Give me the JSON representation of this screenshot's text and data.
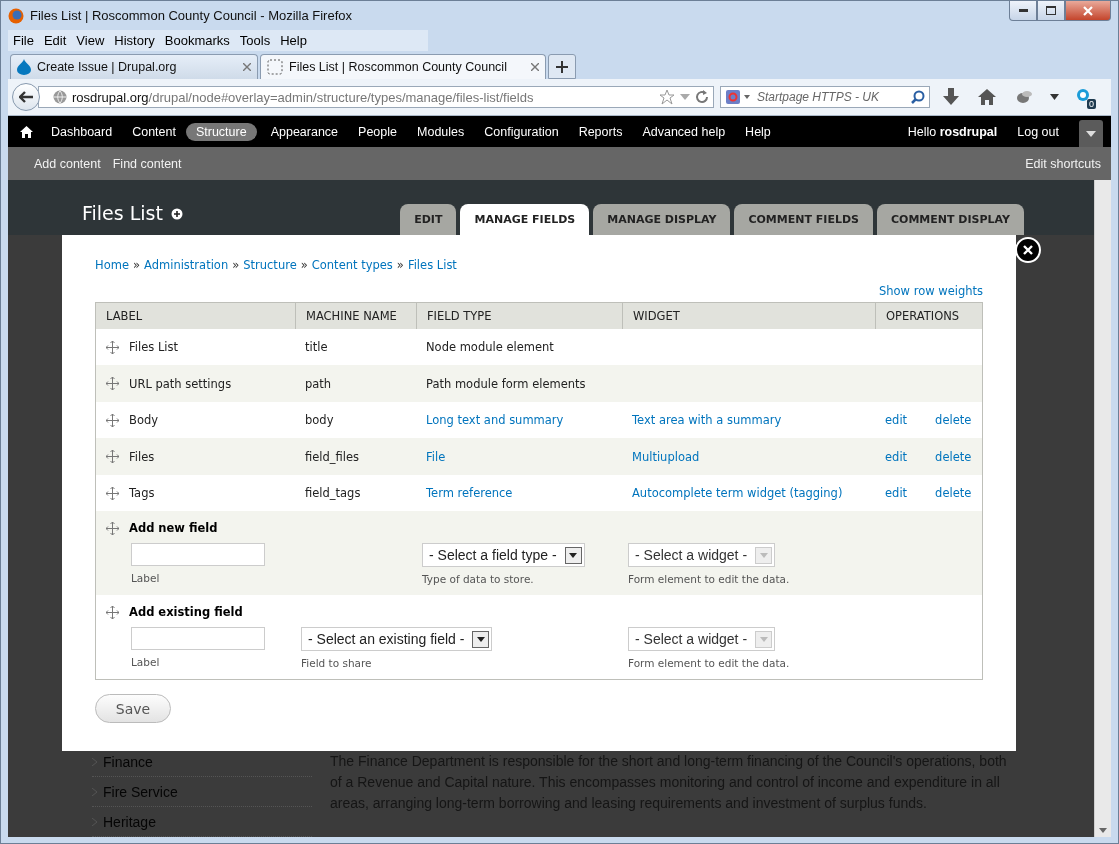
{
  "window": {
    "title": "Files List | Roscommon County Council - Mozilla Firefox"
  },
  "menu": [
    {
      "label": "File"
    },
    {
      "label": "Edit"
    },
    {
      "label": "View"
    },
    {
      "label": "History"
    },
    {
      "label": "Bookmarks"
    },
    {
      "label": "Tools"
    },
    {
      "label": "Help"
    }
  ],
  "browser_tabs": [
    {
      "label": "Create Issue | Drupal.org",
      "kind": "drupal",
      "selected": false
    },
    {
      "label": "Files List | Roscommon County Council",
      "kind": "blank",
      "selected": true
    }
  ],
  "address": {
    "host": "rosdrupal.org",
    "path": "/drupal/node#overlay=admin/structure/types/manage/files-list/fields"
  },
  "search": {
    "placeholder": "Startpage HTTPS - UK"
  },
  "addon_badge": "0",
  "toolbar": {
    "items": [
      {
        "label": "Dashboard",
        "selected": false
      },
      {
        "label": "Content",
        "selected": false
      },
      {
        "label": "Structure",
        "selected": true
      },
      {
        "label": "Appearance",
        "selected": false
      },
      {
        "label": "People",
        "selected": false
      },
      {
        "label": "Modules",
        "selected": false
      },
      {
        "label": "Configuration",
        "selected": false
      },
      {
        "label": "Reports",
        "selected": false
      },
      {
        "label": "Advanced help",
        "selected": false
      },
      {
        "label": "Help",
        "selected": false
      }
    ],
    "greeting": "Hello **rosdrupal**",
    "logout": "Log out"
  },
  "shortcuts": {
    "items": [
      "Add content",
      "Find content"
    ],
    "edit": "Edit shortcuts"
  },
  "page": {
    "title": "Files List",
    "tabs": [
      {
        "label": "EDIT",
        "selected": false
      },
      {
        "label": "MANAGE FIELDS",
        "selected": true
      },
      {
        "label": "MANAGE DISPLAY",
        "selected": false
      },
      {
        "label": "COMMENT FIELDS",
        "selected": false
      },
      {
        "label": "COMMENT DISPLAY",
        "selected": false
      }
    ]
  },
  "overlay": {
    "breadcrumb": [
      "Home",
      "Administration",
      "Structure",
      "Content types",
      "Files List"
    ],
    "breadcrumb_separator": "»",
    "row_weights": "Show row weights",
    "table": {
      "columns": [
        "LABEL",
        "MACHINE NAME",
        "FIELD TYPE",
        "WIDGET",
        "OPERATIONS"
      ],
      "rows": [
        {
          "label": "Files List",
          "machine_name": "title",
          "field_type": "Node module element",
          "kind": "locked"
        },
        {
          "label": "URL path settings",
          "machine_name": "path",
          "field_type": "Path module form elements",
          "kind": "locked"
        },
        {
          "label": "Body",
          "machine_name": "body",
          "field_type": "Long text and summary",
          "widget": "Text area with a summary",
          "operations": [
            "edit",
            "delete"
          ],
          "kind": "field"
        },
        {
          "label": "Files",
          "machine_name": "field_files",
          "field_type": "File",
          "widget": "Multiupload",
          "operations": [
            "edit",
            "delete"
          ],
          "kind": "field"
        },
        {
          "label": "Tags",
          "machine_name": "field_tags",
          "field_type": "Term reference",
          "widget": "Autocomplete term widget (tagging)",
          "operations": [
            "edit",
            "delete"
          ],
          "kind": "field"
        }
      ],
      "add_rows": [
        {
          "title": "Add new field",
          "label_hint": "Label",
          "field_type_select": {
            "value": "- Select a field type -",
            "hint": "Type of data to store.",
            "disabled": false
          },
          "widget_select": {
            "value": "- Select a widget -",
            "hint": "Form element to edit the data.",
            "disabled": true
          }
        },
        {
          "title": "Add existing field",
          "label_hint": "Label",
          "existing_field_select": {
            "value": "- Select an existing field -",
            "hint": "Field to share",
            "disabled": false
          },
          "widget_select": {
            "value": "- Select a widget -",
            "hint": "Form element to edit the data.",
            "disabled": true
          }
        }
      ]
    },
    "save": "Save"
  },
  "background": {
    "sidebar": [
      "Finance",
      "Fire Service",
      "Heritage"
    ],
    "text": "The Finance Department is responsible for the short and long-term financing of the Council's operations, both of a Revenue and Capital nature. This encompasses monitoring and control of income and expenditure in all areas, arranging long-term borrowing and leasing requirements and investment of surplus funds."
  }
}
